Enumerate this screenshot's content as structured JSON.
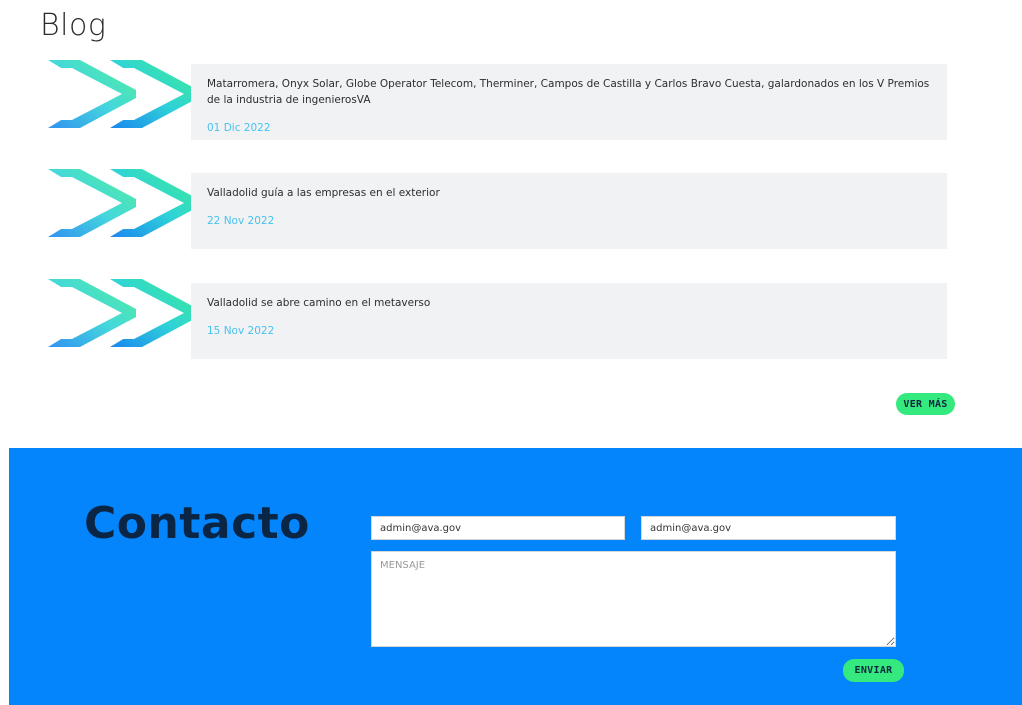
{
  "blog": {
    "title": "Blog",
    "posts": [
      {
        "title": "Matarromera, Onyx Solar, Globe Operator Telecom, Therminer, Campos de Castilla y Carlos Bravo Cuesta, galardonados en los V Premios de la industria de ingenierosVA",
        "date": "01 Dic 2022"
      },
      {
        "title": "Valladolid guía a las empresas en el exterior",
        "date": "22 Nov 2022"
      },
      {
        "title": "Valladolid se abre camino en el metaverso",
        "date": "15 Nov 2022"
      }
    ],
    "more_button": "VER MÁS",
    "logo_icon": "double-chevron-right-icon"
  },
  "contact": {
    "title": "Contacto",
    "email_1": {
      "value": "admin@ava.gov"
    },
    "email_2": {
      "value": "admin@ava.gov"
    },
    "message": {
      "placeholder": "MENSAJE"
    },
    "submit_button": "ENVIAR"
  },
  "colors": {
    "accent_green": "#34ea7f",
    "date_blue": "#46c2ef",
    "contact_bg": "#0585fb",
    "heading_dark": "#0b2545",
    "card_bg": "#f1f2f4"
  }
}
